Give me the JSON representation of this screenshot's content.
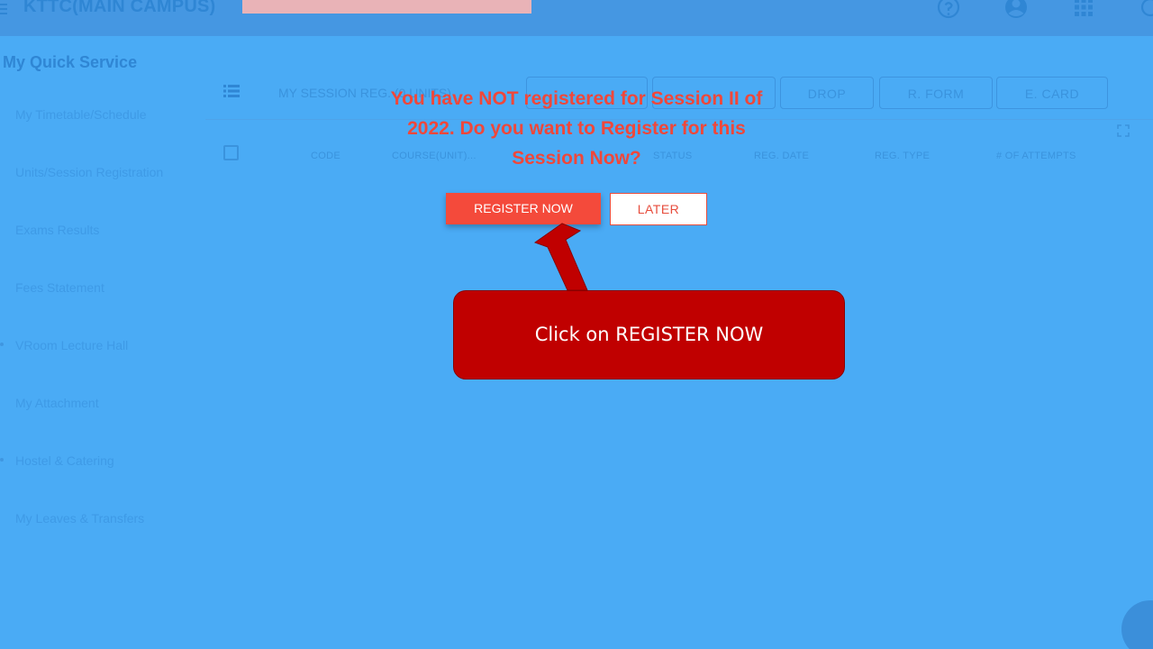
{
  "header": {
    "app_title": "KTTC(MAIN CAMPUS)",
    "icons": [
      "menu-icon",
      "help-icon",
      "account-icon",
      "apps-icon",
      "search-icon"
    ]
  },
  "sidebar": {
    "heading": "My Quick Service",
    "items": [
      {
        "label": "My Timetable/Schedule"
      },
      {
        "label": "Units/Session Registration"
      },
      {
        "label": "Exams Results"
      },
      {
        "label": "Fees Statement"
      },
      {
        "label": "VRoom Lecture Hall"
      },
      {
        "label": "My Attachment"
      },
      {
        "label": "Hostel & Catering"
      },
      {
        "label": "My Leaves & Transfers"
      }
    ]
  },
  "panel": {
    "title": "MY SESSION REG. (0 UNITS)",
    "tabs": [
      "DROP",
      "R. FORM",
      "E. CARD"
    ],
    "columns": [
      "CODE",
      "COURSE(UNIT)...",
      "STATUS",
      "REG. DATE",
      "REG. TYPE",
      "# OF ATTEMPTS"
    ]
  },
  "dialog": {
    "message": "You have NOT registered for Session II of 2022. Do you want to Register for this Session Now?",
    "register_label": "REGISTER NOW",
    "later_label": "LATER"
  },
  "annotation": {
    "callout_text": "Click on REGISTER NOW"
  },
  "colors": {
    "background": "#4aabf5",
    "topbar": "#4597e2",
    "prompt_text": "#f0473a",
    "register_button": "#f44a3b",
    "callout": "#c00000"
  }
}
